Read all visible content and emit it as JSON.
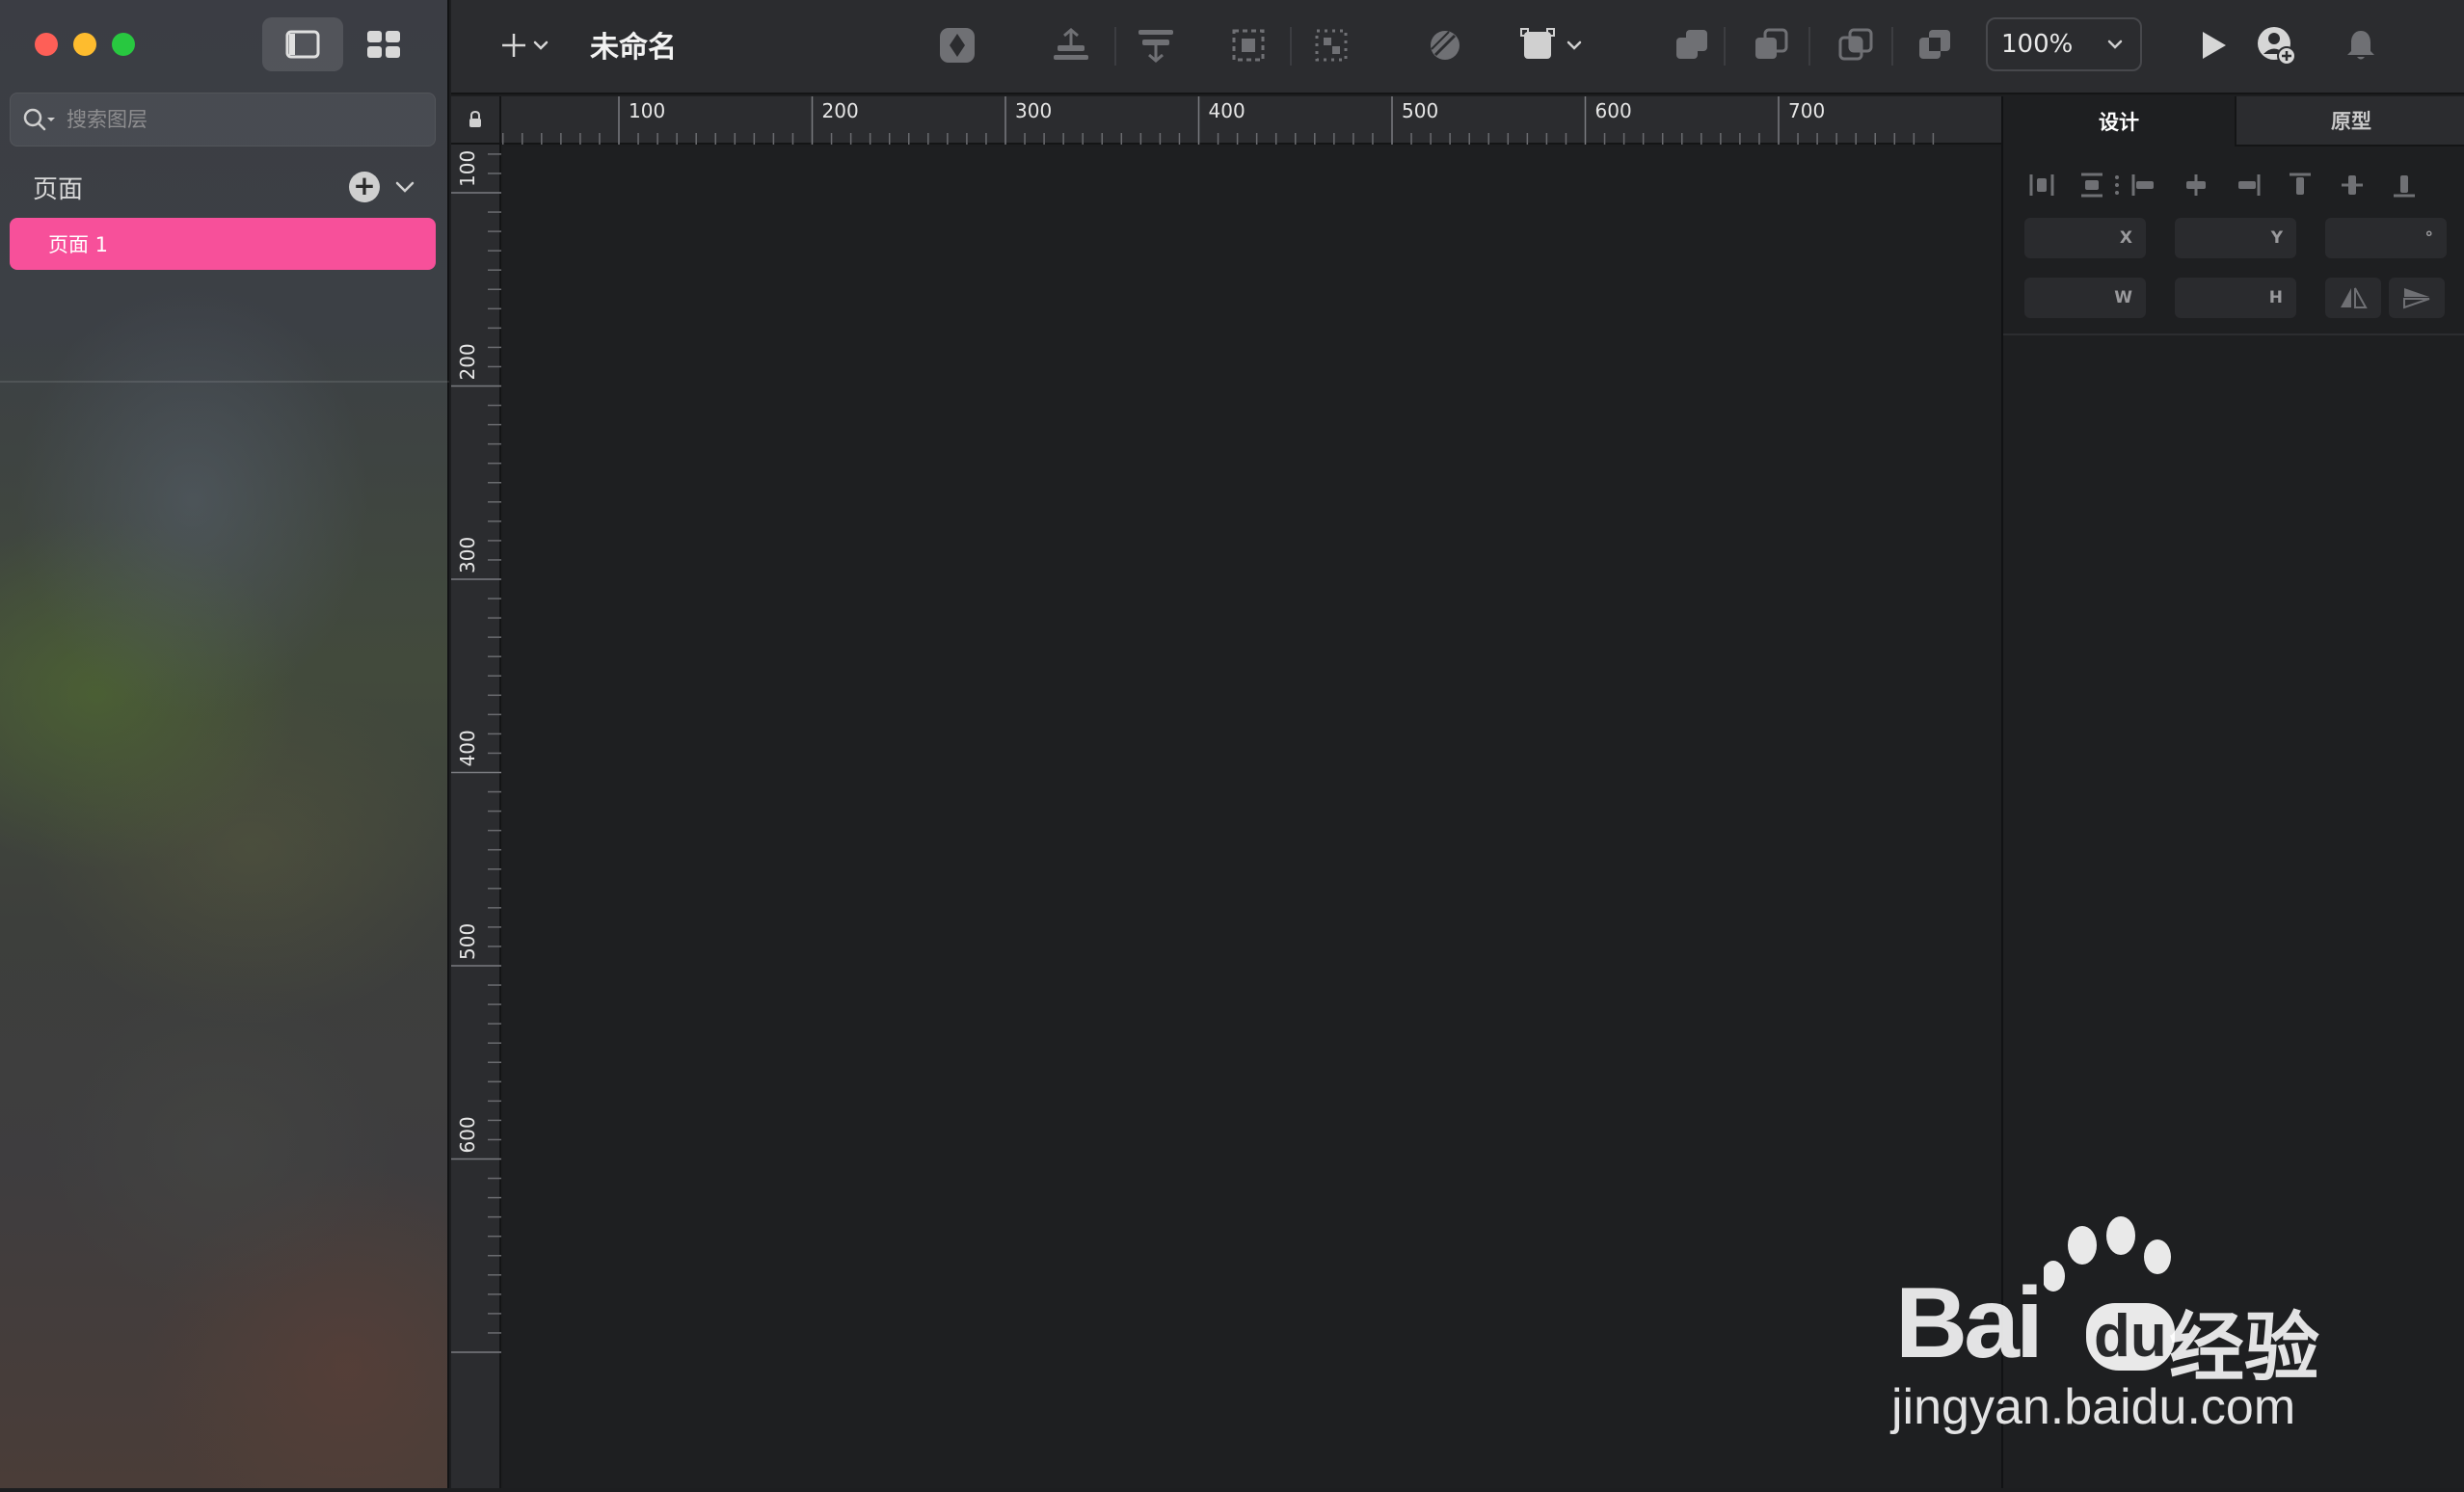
{
  "window": {
    "document_title": "未命名"
  },
  "sidebar": {
    "search_placeholder": "搜索图层",
    "pages_title": "页面",
    "pages": [
      {
        "label": "页面 1",
        "selected": true
      }
    ]
  },
  "toolbar": {
    "zoom": "100%"
  },
  "rulers": {
    "top_labels": [
      "100",
      "200",
      "300",
      "400",
      "500",
      "600",
      "700"
    ],
    "left_labels": [
      "100",
      "200",
      "300",
      "400",
      "500",
      "600"
    ]
  },
  "inspector": {
    "tabs": [
      {
        "label": "设计",
        "active": true
      },
      {
        "label": "原型",
        "active": false
      }
    ],
    "fields": {
      "x_label": "X",
      "y_label": "Y",
      "rotation_label": "°",
      "w_label": "W",
      "h_label": "H"
    }
  },
  "watermark": {
    "brand": "Bai",
    "brand2": "du",
    "suffix": "经验",
    "url": "jingyan.baidu.com"
  },
  "colors": {
    "accent": "#f7509a",
    "canvas": "#1e1f21",
    "toolbar": "#2b2c2f"
  }
}
